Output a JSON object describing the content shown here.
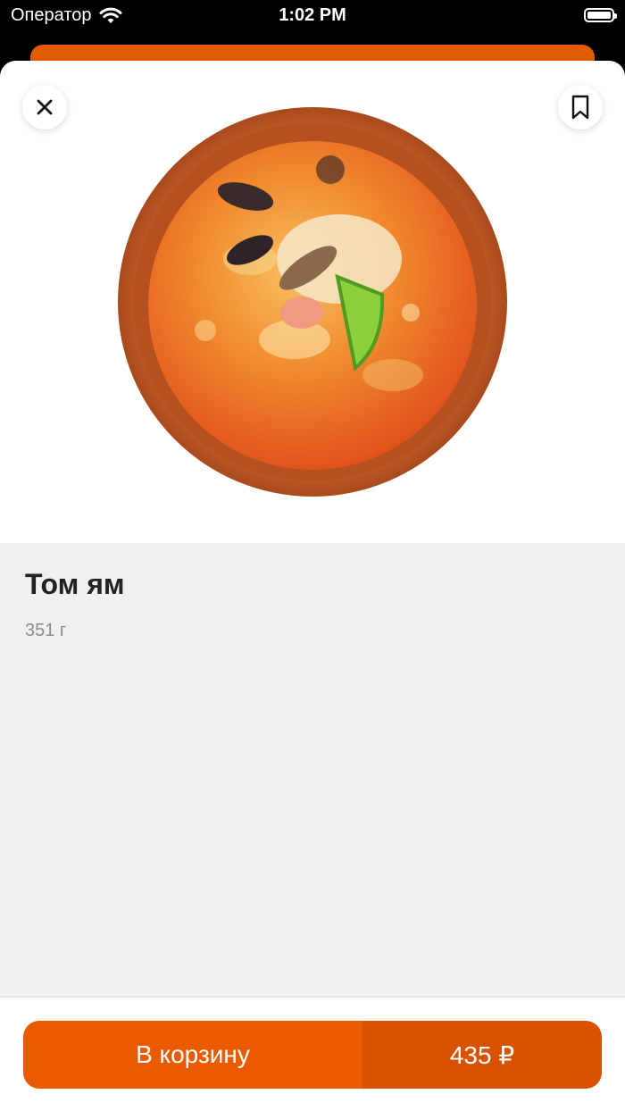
{
  "status_bar": {
    "carrier": "Оператор",
    "time": "1:02 PM"
  },
  "product": {
    "title": "Том ям",
    "weight": "351 г",
    "image_icon": "soup-bowl-image"
  },
  "actions": {
    "close_icon": "close-icon",
    "bookmark_icon": "bookmark-icon",
    "add_to_cart_label": "В корзину",
    "price": "435 ₽"
  },
  "colors": {
    "accent": "#ec5a00",
    "accent_dark": "#d85200",
    "background": "#eff0f2"
  }
}
